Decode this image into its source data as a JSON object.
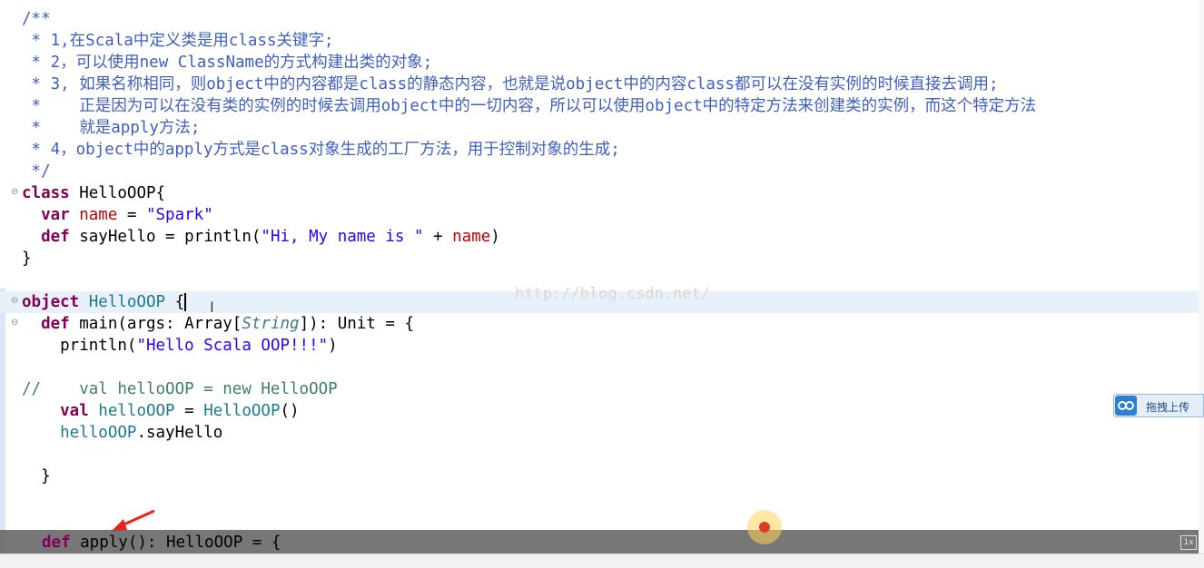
{
  "lines": {
    "c1": "/**",
    "c2": " * 1,在Scala中定义类是用class关键字;",
    "c3": " * 2，可以使用new ClassName的方式构建出类的对象;",
    "c4": " * 3, 如果名称相同，则object中的内容都是class的静态内容，也就是说object中的内容class都可以在没有实例的时候直接去调用;",
    "c5": " *    正是因为可以在没有类的实例的时候去调用object中的一切内容，所以可以使用object中的特定方法来创建类的实例，而这个特定方法",
    "c6": " *    就是apply方法;",
    "c7": " * 4，object中的apply方式是class对象生成的工厂方法，用于控制对象的生成;",
    "c8": " */"
  },
  "tokens": {
    "class_kw": "class",
    "class_name": " HelloOOP{",
    "var_kw": "  var",
    "name_field": " name",
    "eq": " = ",
    "spark_str": "\"Spark\"",
    "def_kw": "  def",
    "say_hello_decl": " sayHello = println(",
    "hi_str": "\"Hi, My name is \"",
    "plus": " + ",
    "name_ref": "name",
    "close_paren": ")",
    "close_brace": "}",
    "object_kw": "object",
    "object_name": " HelloOOP",
    "object_brace": " {",
    "main_decl_a": " main(args: Array[",
    "string_type": "String",
    "main_decl_b": "]): Unit = {",
    "println_a": "    println(",
    "hello_str": "\"Hello Scala OOP!!!\"",
    "comment_line": "//    val helloOOP = new HelloOOP",
    "val_kw": "    val",
    "hello_var": " helloOOP",
    "hello_call": "HelloOOP",
    "parens": "()",
    "hello_ref": "    helloOOP",
    "say_hello_call": ".sayHello",
    "inner_close": "  }",
    "apply_def_kw": "def",
    "apply_rest": " apply(): HelloOOP = {"
  },
  "watermark": "http://blog.csdn.net/",
  "upload_widget": {
    "label": "拖拽上传"
  },
  "playback": {
    "speed": "1x"
  },
  "colors": {
    "keyword": "#7f0055",
    "comment": "#3f5fbf",
    "string": "#2a00ff",
    "field": "#c00000",
    "object_name": "#1a7a8a",
    "line_comment": "#3f7f5f",
    "current_line": "#e8f0fa"
  },
  "icons": {
    "fold": "fold-minus-icon",
    "upload": "cloud-upload-icon",
    "cursor": "ibeam-cursor-icon",
    "annotation": "red-arrow-icon",
    "recording": "click-indicator-icon"
  }
}
